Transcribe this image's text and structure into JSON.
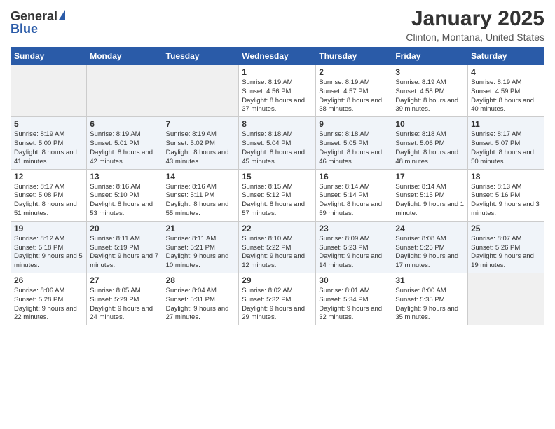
{
  "header": {
    "logo_general": "General",
    "logo_blue": "Blue",
    "month": "January 2025",
    "location": "Clinton, Montana, United States"
  },
  "days_of_week": [
    "Sunday",
    "Monday",
    "Tuesday",
    "Wednesday",
    "Thursday",
    "Friday",
    "Saturday"
  ],
  "weeks": [
    [
      {
        "day": "",
        "info": ""
      },
      {
        "day": "",
        "info": ""
      },
      {
        "day": "",
        "info": ""
      },
      {
        "day": "1",
        "info": "Sunrise: 8:19 AM\nSunset: 4:56 PM\nDaylight: 8 hours\nand 37 minutes."
      },
      {
        "day": "2",
        "info": "Sunrise: 8:19 AM\nSunset: 4:57 PM\nDaylight: 8 hours\nand 38 minutes."
      },
      {
        "day": "3",
        "info": "Sunrise: 8:19 AM\nSunset: 4:58 PM\nDaylight: 8 hours\nand 39 minutes."
      },
      {
        "day": "4",
        "info": "Sunrise: 8:19 AM\nSunset: 4:59 PM\nDaylight: 8 hours\nand 40 minutes."
      }
    ],
    [
      {
        "day": "5",
        "info": "Sunrise: 8:19 AM\nSunset: 5:00 PM\nDaylight: 8 hours\nand 41 minutes."
      },
      {
        "day": "6",
        "info": "Sunrise: 8:19 AM\nSunset: 5:01 PM\nDaylight: 8 hours\nand 42 minutes."
      },
      {
        "day": "7",
        "info": "Sunrise: 8:19 AM\nSunset: 5:02 PM\nDaylight: 8 hours\nand 43 minutes."
      },
      {
        "day": "8",
        "info": "Sunrise: 8:18 AM\nSunset: 5:04 PM\nDaylight: 8 hours\nand 45 minutes."
      },
      {
        "day": "9",
        "info": "Sunrise: 8:18 AM\nSunset: 5:05 PM\nDaylight: 8 hours\nand 46 minutes."
      },
      {
        "day": "10",
        "info": "Sunrise: 8:18 AM\nSunset: 5:06 PM\nDaylight: 8 hours\nand 48 minutes."
      },
      {
        "day": "11",
        "info": "Sunrise: 8:17 AM\nSunset: 5:07 PM\nDaylight: 8 hours\nand 50 minutes."
      }
    ],
    [
      {
        "day": "12",
        "info": "Sunrise: 8:17 AM\nSunset: 5:08 PM\nDaylight: 8 hours\nand 51 minutes."
      },
      {
        "day": "13",
        "info": "Sunrise: 8:16 AM\nSunset: 5:10 PM\nDaylight: 8 hours\nand 53 minutes."
      },
      {
        "day": "14",
        "info": "Sunrise: 8:16 AM\nSunset: 5:11 PM\nDaylight: 8 hours\nand 55 minutes."
      },
      {
        "day": "15",
        "info": "Sunrise: 8:15 AM\nSunset: 5:12 PM\nDaylight: 8 hours\nand 57 minutes."
      },
      {
        "day": "16",
        "info": "Sunrise: 8:14 AM\nSunset: 5:14 PM\nDaylight: 8 hours\nand 59 minutes."
      },
      {
        "day": "17",
        "info": "Sunrise: 8:14 AM\nSunset: 5:15 PM\nDaylight: 9 hours\nand 1 minute."
      },
      {
        "day": "18",
        "info": "Sunrise: 8:13 AM\nSunset: 5:16 PM\nDaylight: 9 hours\nand 3 minutes."
      }
    ],
    [
      {
        "day": "19",
        "info": "Sunrise: 8:12 AM\nSunset: 5:18 PM\nDaylight: 9 hours\nand 5 minutes."
      },
      {
        "day": "20",
        "info": "Sunrise: 8:11 AM\nSunset: 5:19 PM\nDaylight: 9 hours\nand 7 minutes."
      },
      {
        "day": "21",
        "info": "Sunrise: 8:11 AM\nSunset: 5:21 PM\nDaylight: 9 hours\nand 10 minutes."
      },
      {
        "day": "22",
        "info": "Sunrise: 8:10 AM\nSunset: 5:22 PM\nDaylight: 9 hours\nand 12 minutes."
      },
      {
        "day": "23",
        "info": "Sunrise: 8:09 AM\nSunset: 5:23 PM\nDaylight: 9 hours\nand 14 minutes."
      },
      {
        "day": "24",
        "info": "Sunrise: 8:08 AM\nSunset: 5:25 PM\nDaylight: 9 hours\nand 17 minutes."
      },
      {
        "day": "25",
        "info": "Sunrise: 8:07 AM\nSunset: 5:26 PM\nDaylight: 9 hours\nand 19 minutes."
      }
    ],
    [
      {
        "day": "26",
        "info": "Sunrise: 8:06 AM\nSunset: 5:28 PM\nDaylight: 9 hours\nand 22 minutes."
      },
      {
        "day": "27",
        "info": "Sunrise: 8:05 AM\nSunset: 5:29 PM\nDaylight: 9 hours\nand 24 minutes."
      },
      {
        "day": "28",
        "info": "Sunrise: 8:04 AM\nSunset: 5:31 PM\nDaylight: 9 hours\nand 27 minutes."
      },
      {
        "day": "29",
        "info": "Sunrise: 8:02 AM\nSunset: 5:32 PM\nDaylight: 9 hours\nand 29 minutes."
      },
      {
        "day": "30",
        "info": "Sunrise: 8:01 AM\nSunset: 5:34 PM\nDaylight: 9 hours\nand 32 minutes."
      },
      {
        "day": "31",
        "info": "Sunrise: 8:00 AM\nSunset: 5:35 PM\nDaylight: 9 hours\nand 35 minutes."
      },
      {
        "day": "",
        "info": ""
      }
    ]
  ]
}
